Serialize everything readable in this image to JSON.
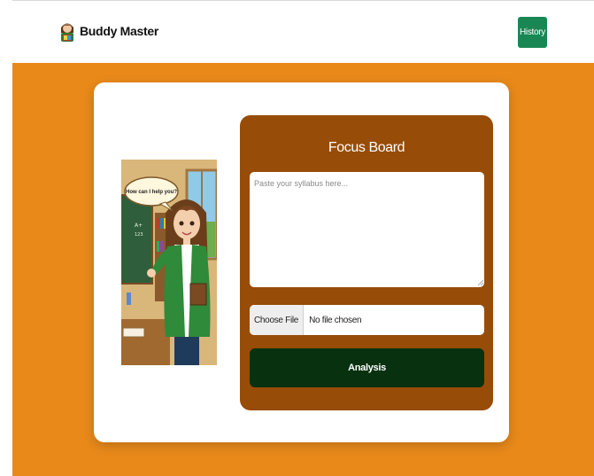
{
  "navbar": {
    "brand_name": "Buddy Master",
    "history_label": "History"
  },
  "illustration": {
    "speech_bubble": "How can I help you?",
    "chalkboard_text": "A+\n123"
  },
  "focus_board": {
    "title": "Focus Board",
    "syllabus_placeholder": "Paste your syllabus here...",
    "syllabus_value": "",
    "choose_file_label": "Choose File",
    "file_status": "No file chosen",
    "analysis_label": "Analysis"
  },
  "colors": {
    "page_background": "#e8891a",
    "card_background": "#ffffff",
    "board_background": "#974c07",
    "analysis_button": "#07310f",
    "history_button": "#198754"
  }
}
